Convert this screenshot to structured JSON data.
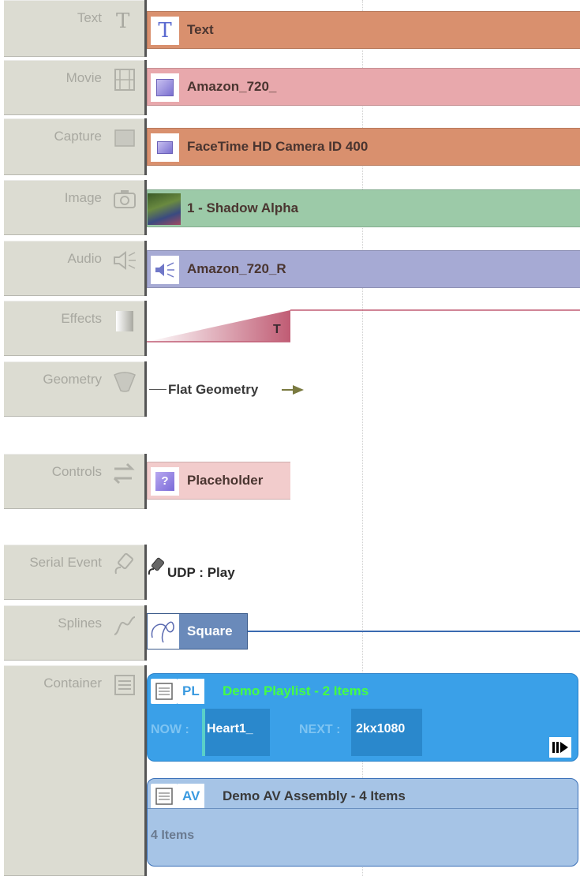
{
  "tracks": [
    {
      "label": "Text",
      "icon": "text-t-icon",
      "clip": {
        "name": "Text",
        "color": "#d9906e",
        "thumb": "T"
      }
    },
    {
      "label": "Movie",
      "icon": "film-icon",
      "clip": {
        "name": "Amazon_720_",
        "color": "#e8a8ac"
      }
    },
    {
      "label": "Capture",
      "icon": "capture-icon",
      "clip": {
        "name": "FaceTime HD Camera ID 400",
        "color": "#d9906e"
      }
    },
    {
      "label": "Image",
      "icon": "camera-icon",
      "clip": {
        "name": "1 - Shadow Alpha",
        "color": "#9ccaa8"
      }
    },
    {
      "label": "Audio",
      "icon": "speaker-icon",
      "clip": {
        "name": "Amazon_720_R",
        "color": "#a6aad4"
      }
    },
    {
      "label": "Effects",
      "icon": "gradient-icon",
      "clip": {
        "name": "T"
      }
    },
    {
      "label": "Geometry",
      "icon": "cone-icon",
      "clip": {
        "name": "Flat Geometry"
      }
    },
    {
      "label": "Controls",
      "icon": "swap-arrows-icon",
      "clip": {
        "name": "Placeholder",
        "thumb": "?"
      }
    },
    {
      "label": "Serial Event",
      "icon": "satellite-icon",
      "clip": {
        "name": "UDP : Play"
      }
    },
    {
      "label": "Splines",
      "icon": "curve-icon",
      "clip": {
        "name": "Square"
      }
    },
    {
      "label": "Container",
      "icon": "list-icon"
    }
  ],
  "containers": {
    "playlist": {
      "tag": "PL",
      "title": "Demo Playlist - 2 Items",
      "now_label": "NOW :",
      "now_value": "Heart1_",
      "next_label": "NEXT :",
      "next_value": "2kx1080",
      "color": "#3aa0e8"
    },
    "assembly": {
      "tag": "AV",
      "title": "Demo AV Assembly - 4 Items",
      "subtitle": "4 Items",
      "color": "#a6c4e6"
    }
  }
}
